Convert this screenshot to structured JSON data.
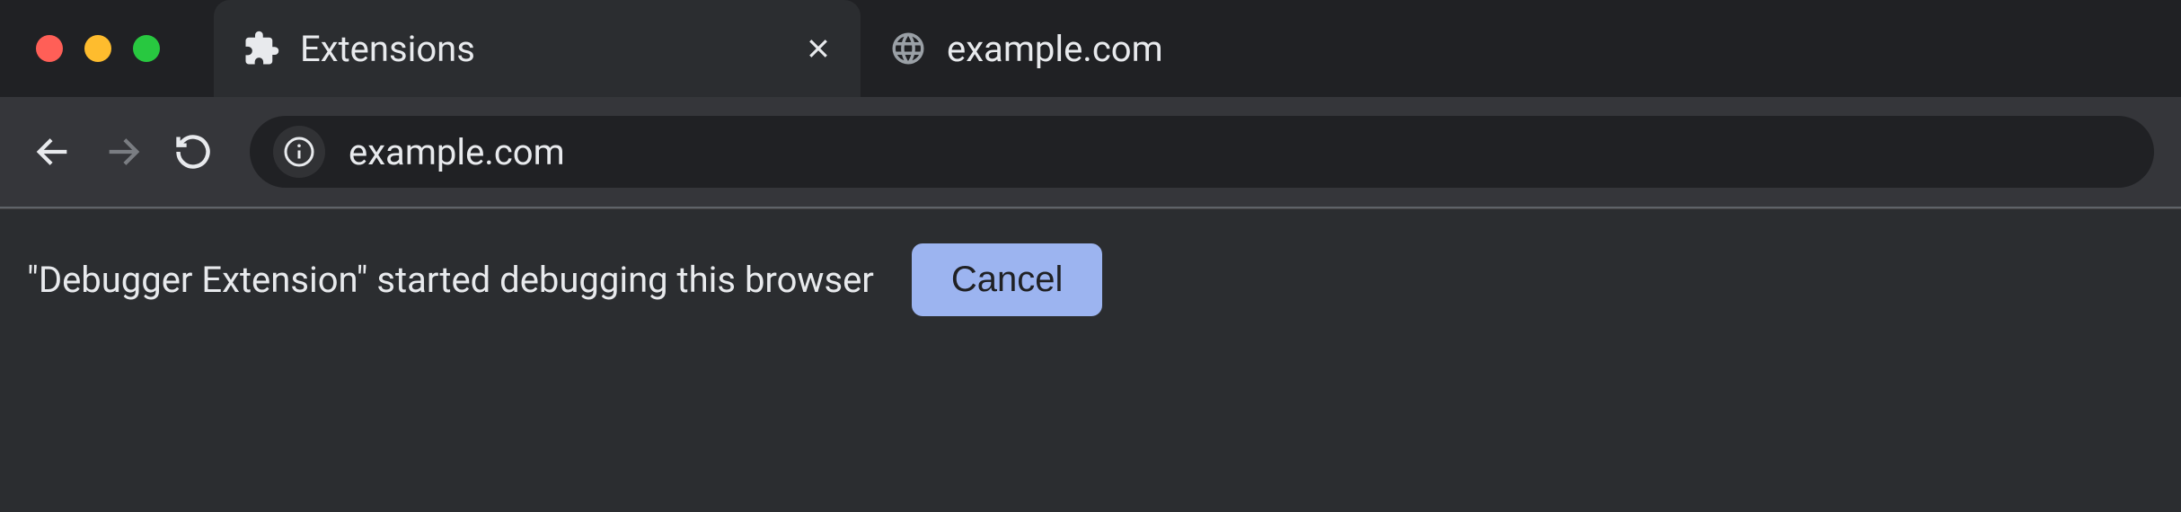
{
  "tabs": [
    {
      "title": "Extensions",
      "icon": "extension-icon",
      "active": false
    },
    {
      "title": "example.com",
      "icon": "globe-icon",
      "active": true
    }
  ],
  "toolbar": {
    "url": "example.com"
  },
  "infobar": {
    "message": "\"Debugger Extension\" started debugging this browser",
    "cancel_label": "Cancel"
  }
}
